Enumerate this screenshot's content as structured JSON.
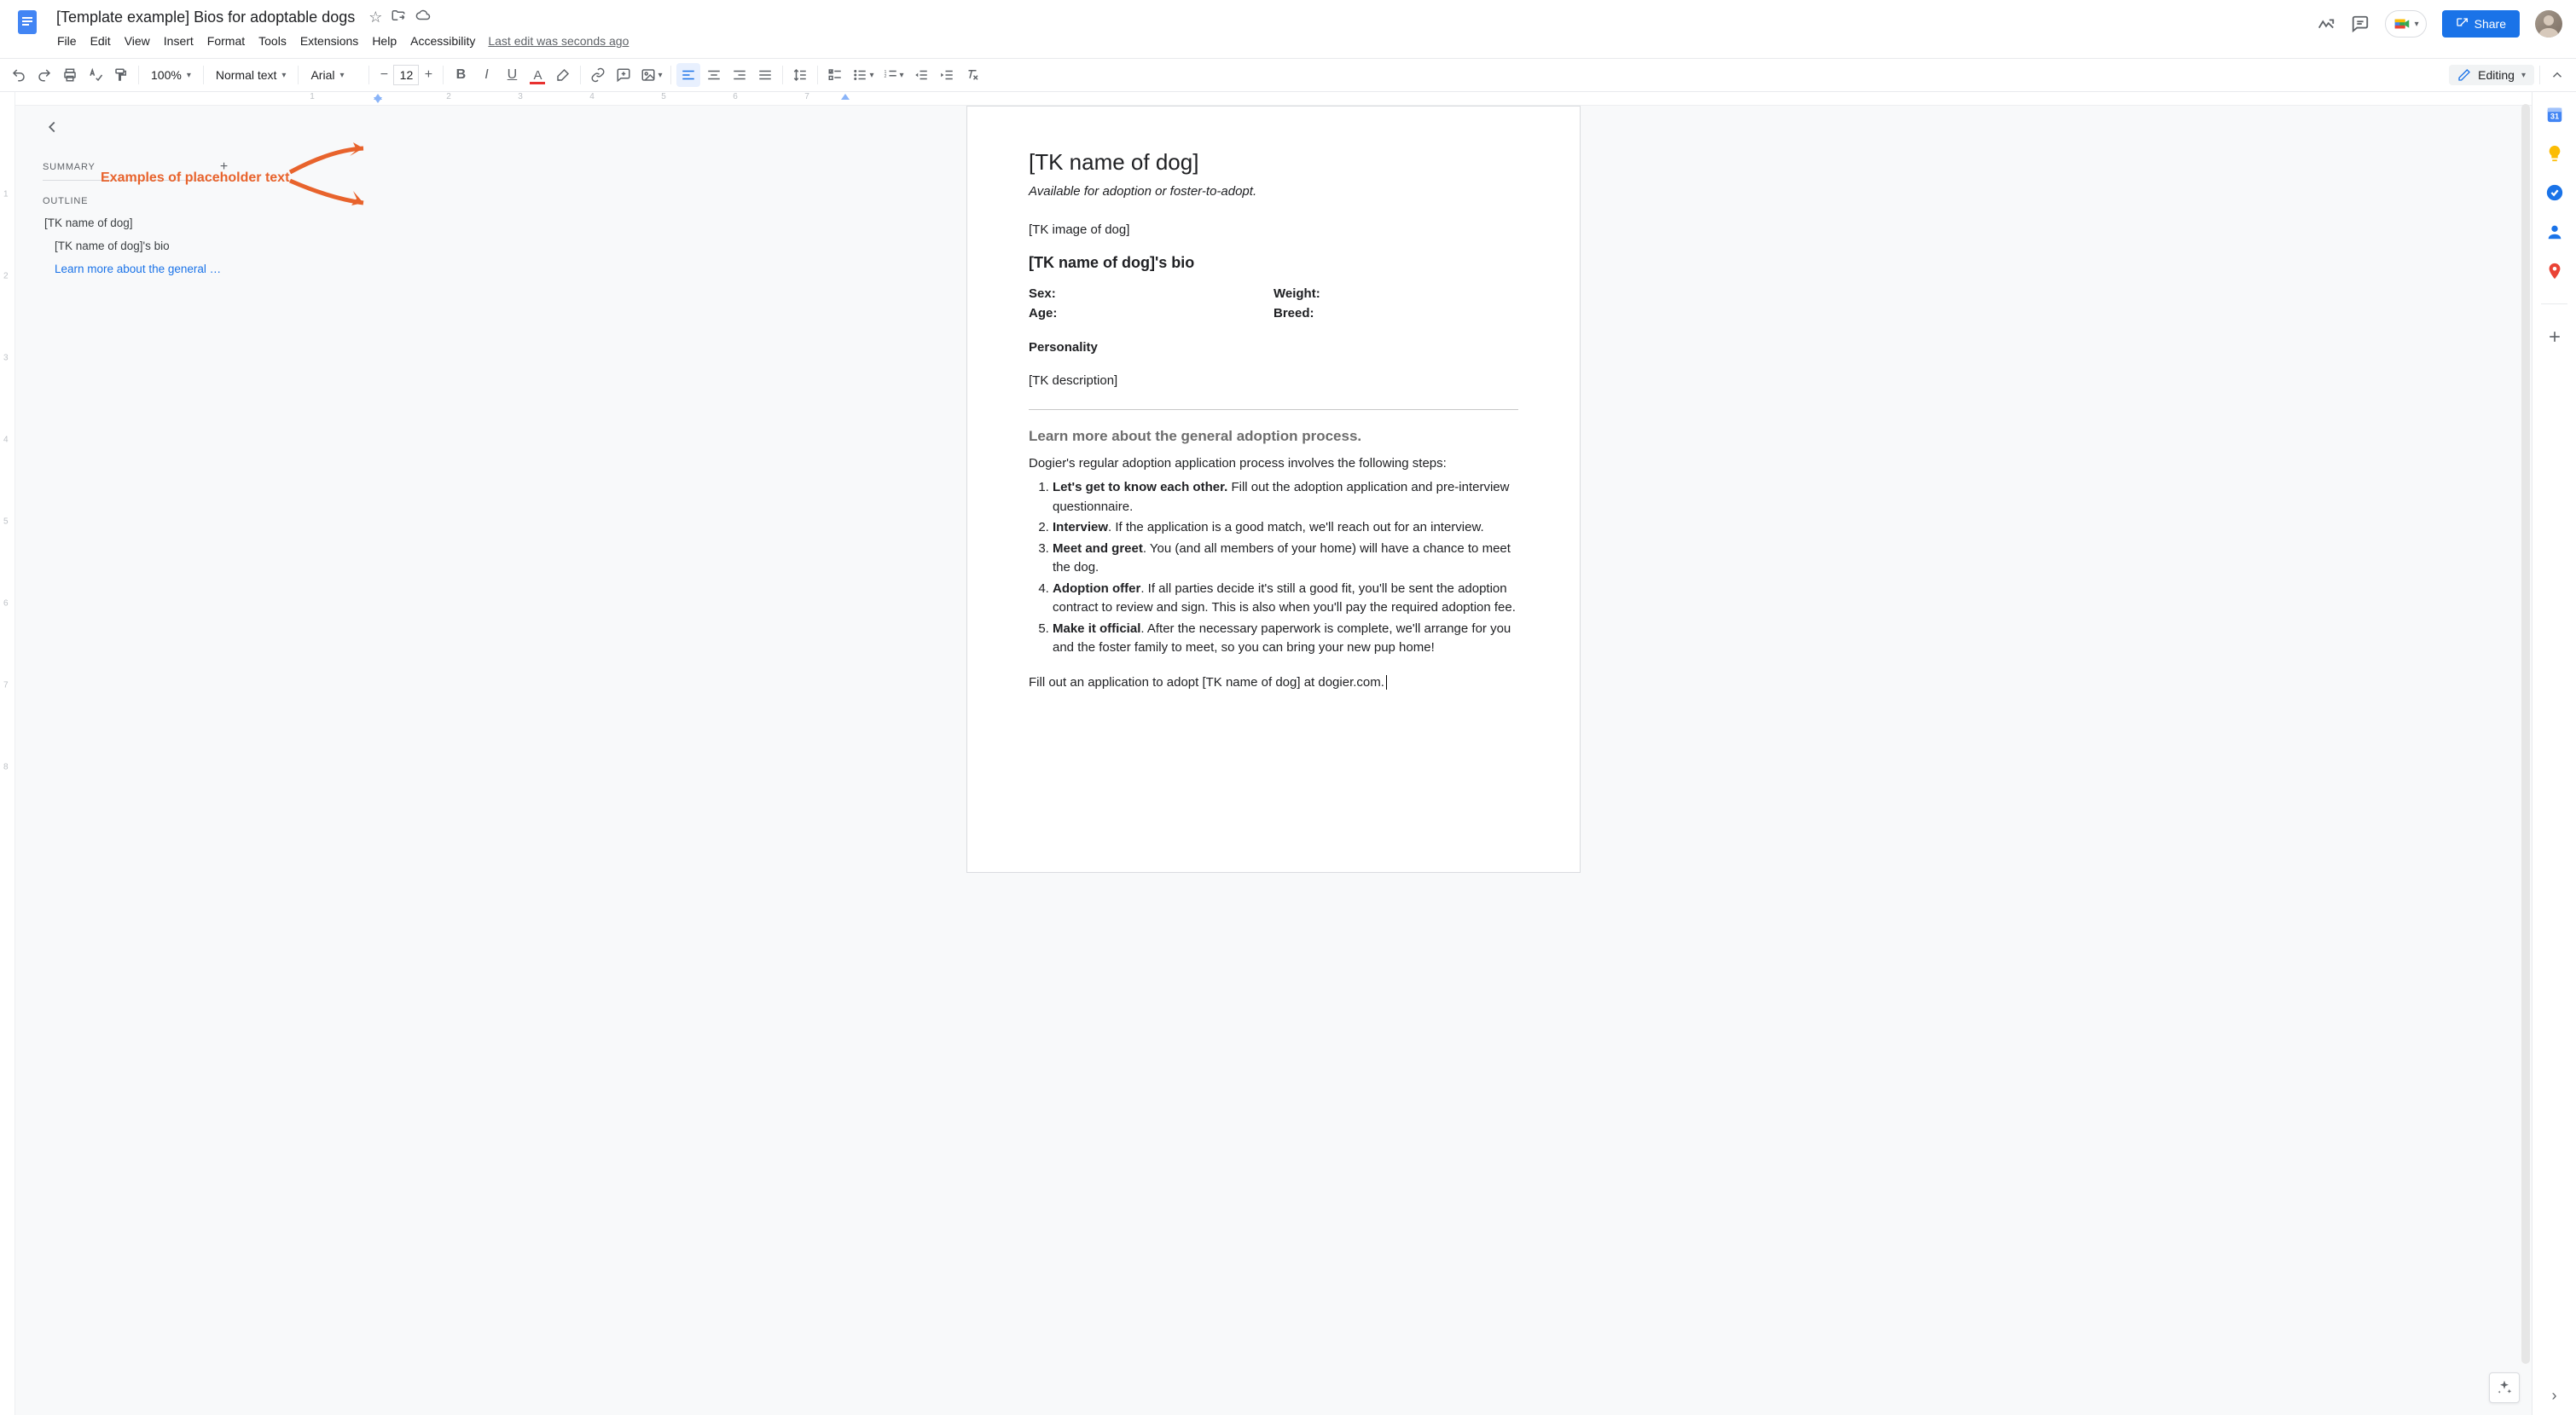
{
  "header": {
    "doc_title": "[Template example] Bios for adoptable dogs",
    "menu": [
      "File",
      "Edit",
      "View",
      "Insert",
      "Format",
      "Tools",
      "Extensions",
      "Help",
      "Accessibility"
    ],
    "last_edit": "Last edit was seconds ago",
    "share_label": "Share"
  },
  "toolbar": {
    "zoom": "100%",
    "style": "Normal text",
    "font": "Arial",
    "font_size": "12",
    "mode_label": "Editing"
  },
  "outline": {
    "summary_label": "SUMMARY",
    "outline_label": "OUTLINE",
    "items": [
      {
        "label": "[TK name of dog]",
        "level": 1,
        "active": false
      },
      {
        "label": "[TK name of dog]'s bio",
        "level": 2,
        "active": false
      },
      {
        "label": "Learn more about the general …",
        "level": 2,
        "active": true
      }
    ]
  },
  "annotation": {
    "label": "Examples of placeholder text"
  },
  "ruler": {
    "h": [
      "1",
      "2",
      "3",
      "4",
      "5",
      "6",
      "7"
    ],
    "v": [
      "1",
      "2",
      "3",
      "4",
      "5",
      "6",
      "7",
      "8"
    ]
  },
  "doc": {
    "title": "[TK name of dog]",
    "subtitle": "Available for adoption or foster-to-adopt.",
    "img_placeholder": "[TK image of dog]",
    "bio_heading": "[TK name of dog]'s bio",
    "fields": {
      "sex": "Sex:",
      "age": "Age:",
      "weight": "Weight:",
      "breed": "Breed:"
    },
    "personality_label": "Personality",
    "description_placeholder": "[TK description]",
    "process_heading": "Learn more about the general adoption process.",
    "process_intro": "Dogier's regular adoption application process involves the following steps:",
    "steps": [
      {
        "b": "Let's get to know each other.",
        "t": " Fill out the adoption application and pre-interview questionnaire."
      },
      {
        "b": "Interview",
        "t": ". If the application is a good match, we'll reach out for an interview."
      },
      {
        "b": "Meet and greet",
        "t": ". You (and all members of your home) will have a chance to meet the dog."
      },
      {
        "b": "Adoption offer",
        "t": ". If all parties decide it's still a good fit, you'll be sent the adoption contract to review and sign. This is also when you'll pay the required adoption fee."
      },
      {
        "b": "Make it official",
        "t": ". After the necessary paperwork is complete, we'll arrange for you and the foster family to meet, so you can bring your new pup home!"
      }
    ],
    "closing": "Fill out an application to adopt [TK name of dog] at dogier.com."
  }
}
